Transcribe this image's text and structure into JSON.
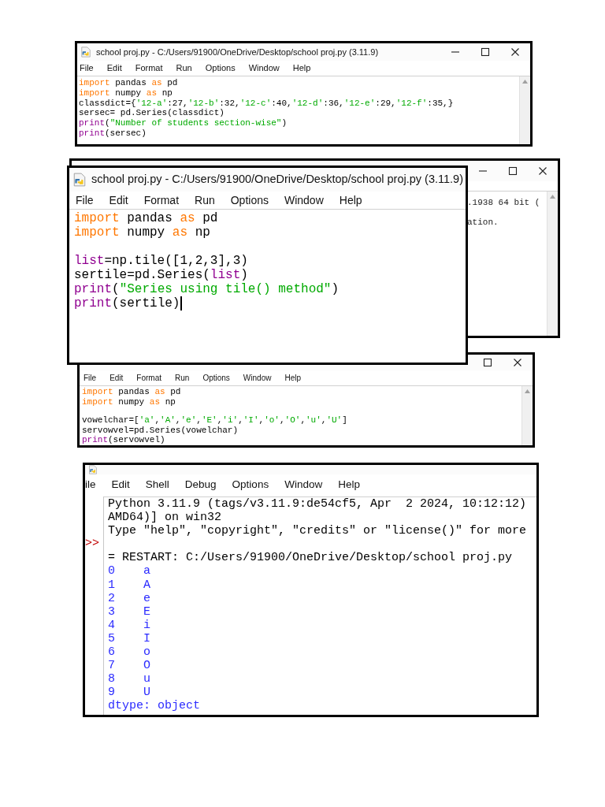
{
  "windows": [
    {
      "kind": "editor",
      "title": "school proj.py - C:/Users/91900/OneDrive/Desktop/school proj.py (3.11.9)",
      "controls": [
        {
          "kind": "minimize"
        },
        {
          "kind": "maximize"
        },
        {
          "kind": "close"
        }
      ],
      "menu": [
        "File",
        "Edit",
        "Format",
        "Run",
        "Options",
        "Window",
        "Help"
      ],
      "scrollbar": true,
      "lines": [
        {
          "kind": "code",
          "tokens": [
            {
              "kind": "keyword",
              "text": "import"
            },
            {
              "kind": "plain",
              "text": " pandas "
            },
            {
              "kind": "keyword",
              "text": "as"
            },
            {
              "kind": "plain",
              "text": " pd"
            }
          ]
        },
        {
          "kind": "code",
          "tokens": [
            {
              "kind": "keyword",
              "text": "import"
            },
            {
              "kind": "plain",
              "text": " numpy "
            },
            {
              "kind": "keyword",
              "text": "as"
            },
            {
              "kind": "plain",
              "text": " np"
            }
          ]
        },
        {
          "kind": "code",
          "tokens": [
            {
              "kind": "plain",
              "text": "classdict={"
            },
            {
              "kind": "string",
              "text": "'12-a'"
            },
            {
              "kind": "plain",
              "text": ":27,"
            },
            {
              "kind": "string",
              "text": "'12-b'"
            },
            {
              "kind": "plain",
              "text": ":32,"
            },
            {
              "kind": "string",
              "text": "'12-c'"
            },
            {
              "kind": "plain",
              "text": ":40,"
            },
            {
              "kind": "string",
              "text": "'12-d'"
            },
            {
              "kind": "plain",
              "text": ":36,"
            },
            {
              "kind": "string",
              "text": "'12-e'"
            },
            {
              "kind": "plain",
              "text": ":29,"
            },
            {
              "kind": "string",
              "text": "'12-f'"
            },
            {
              "kind": "plain",
              "text": ":35,}"
            }
          ]
        },
        {
          "kind": "code",
          "tokens": [
            {
              "kind": "plain",
              "text": "sersec= pd.Series(classdict)"
            }
          ]
        },
        {
          "kind": "code",
          "tokens": [
            {
              "kind": "builtin",
              "text": "print"
            },
            {
              "kind": "plain",
              "text": "("
            },
            {
              "kind": "string",
              "text": "\"Number of students section-wise\""
            },
            {
              "kind": "plain",
              "text": ")"
            }
          ]
        },
        {
          "kind": "code",
          "tokens": [
            {
              "kind": "builtin",
              "text": "print"
            },
            {
              "kind": "plain",
              "text": "(sersec)"
            }
          ]
        }
      ]
    },
    {
      "kind": "background",
      "controls": [
        {
          "kind": "minimize"
        },
        {
          "kind": "maximize"
        },
        {
          "kind": "close"
        }
      ],
      "scrollbar": true,
      "lines": [
        {
          "text": ".1938 64 bit ("
        },
        {
          "text": "ation."
        }
      ]
    },
    {
      "kind": "editor",
      "title": "school proj.py - C:/Users/91900/OneDrive/Desktop/school proj.py (3.11.9)",
      "menu": [
        "File",
        "Edit",
        "Format",
        "Run",
        "Options",
        "Window",
        "Help"
      ],
      "caret": true,
      "lines": [
        {
          "kind": "code",
          "tokens": [
            {
              "kind": "keyword",
              "text": "import"
            },
            {
              "kind": "plain",
              "text": " pandas "
            },
            {
              "kind": "keyword",
              "text": "as"
            },
            {
              "kind": "plain",
              "text": " pd"
            }
          ]
        },
        {
          "kind": "code",
          "tokens": [
            {
              "kind": "keyword",
              "text": "import"
            },
            {
              "kind": "plain",
              "text": " numpy "
            },
            {
              "kind": "keyword",
              "text": "as"
            },
            {
              "kind": "plain",
              "text": " np"
            }
          ]
        },
        {
          "kind": "blank"
        },
        {
          "kind": "code",
          "tokens": [
            {
              "kind": "builtin",
              "text": "list"
            },
            {
              "kind": "plain",
              "text": "=np.tile([1,2,3],3)"
            }
          ]
        },
        {
          "kind": "code",
          "tokens": [
            {
              "kind": "plain",
              "text": "sertile=pd.Series("
            },
            {
              "kind": "builtin",
              "text": "list"
            },
            {
              "kind": "plain",
              "text": ")"
            }
          ]
        },
        {
          "kind": "code",
          "tokens": [
            {
              "kind": "builtin",
              "text": "print"
            },
            {
              "kind": "plain",
              "text": "("
            },
            {
              "kind": "string",
              "text": "\"Series using tile() method\""
            },
            {
              "kind": "plain",
              "text": ")"
            }
          ]
        },
        {
          "kind": "code",
          "tokens": [
            {
              "kind": "builtin",
              "text": "print"
            },
            {
              "kind": "plain",
              "text": "(sertile)"
            }
          ]
        }
      ]
    },
    {
      "kind": "editor",
      "controls": [
        {
          "kind": "maximize"
        },
        {
          "kind": "close"
        }
      ],
      "menu": [
        "File",
        "Edit",
        "Format",
        "Run",
        "Options",
        "Window",
        "Help"
      ],
      "scrollbar": true,
      "lines": [
        {
          "kind": "code",
          "tokens": [
            {
              "kind": "keyword",
              "text": "import"
            },
            {
              "kind": "plain",
              "text": " pandas "
            },
            {
              "kind": "keyword",
              "text": "as"
            },
            {
              "kind": "plain",
              "text": " pd"
            }
          ]
        },
        {
          "kind": "code",
          "tokens": [
            {
              "kind": "keyword",
              "text": "import"
            },
            {
              "kind": "plain",
              "text": " numpy "
            },
            {
              "kind": "keyword",
              "text": "as"
            },
            {
              "kind": "plain",
              "text": " np"
            }
          ]
        },
        {
          "kind": "blank"
        },
        {
          "kind": "code",
          "tokens": [
            {
              "kind": "plain",
              "text": "vowelchar=["
            },
            {
              "kind": "string",
              "text": "'a'"
            },
            {
              "kind": "plain",
              "text": ","
            },
            {
              "kind": "string",
              "text": "'A'"
            },
            {
              "kind": "plain",
              "text": ","
            },
            {
              "kind": "string",
              "text": "'e'"
            },
            {
              "kind": "plain",
              "text": ","
            },
            {
              "kind": "string",
              "text": "'E'"
            },
            {
              "kind": "plain",
              "text": ","
            },
            {
              "kind": "string",
              "text": "'i'"
            },
            {
              "kind": "plain",
              "text": ","
            },
            {
              "kind": "string",
              "text": "'I'"
            },
            {
              "kind": "plain",
              "text": ","
            },
            {
              "kind": "string",
              "text": "'o'"
            },
            {
              "kind": "plain",
              "text": ","
            },
            {
              "kind": "string",
              "text": "'O'"
            },
            {
              "kind": "plain",
              "text": ","
            },
            {
              "kind": "string",
              "text": "'u'"
            },
            {
              "kind": "plain",
              "text": ","
            },
            {
              "kind": "string",
              "text": "'U'"
            },
            {
              "kind": "plain",
              "text": "]"
            }
          ]
        },
        {
          "kind": "code",
          "tokens": [
            {
              "kind": "plain",
              "text": "servowvel=pd.Series(vowelchar)"
            }
          ]
        },
        {
          "kind": "code",
          "tokens": [
            {
              "kind": "builtin",
              "text": "print"
            },
            {
              "kind": "plain",
              "text": "(servowvel)"
            }
          ]
        }
      ]
    },
    {
      "kind": "shell",
      "menu": [
        "ile",
        "Edit",
        "Shell",
        "Debug",
        "Options",
        "Window",
        "Help"
      ],
      "lines": [
        {
          "kind": "plain",
          "text": "Python 3.11.9 (tags/v3.11.9:de54cf5, Apr  2 2024, 10:12:12)"
        },
        {
          "kind": "plain",
          "text": "AMD64)] on win32"
        },
        {
          "kind": "plain",
          "text": "Type \"help\", \"copyright\", \"credits\" or \"license()\" for more"
        },
        {
          "kind": "prompt",
          "text": ">>"
        },
        {
          "kind": "plain",
          "text": "= RESTART: C:/Users/91900/OneDrive/Desktop/school proj.py"
        },
        {
          "kind": "output",
          "text": "0    a"
        },
        {
          "kind": "output",
          "text": "1    A"
        },
        {
          "kind": "output",
          "text": "2    e"
        },
        {
          "kind": "output",
          "text": "3    E"
        },
        {
          "kind": "output",
          "text": "4    i"
        },
        {
          "kind": "output",
          "text": "5    I"
        },
        {
          "kind": "output",
          "text": "6    o"
        },
        {
          "kind": "output",
          "text": "7    O"
        },
        {
          "kind": "output",
          "text": "8    u"
        },
        {
          "kind": "output",
          "text": "9    U"
        },
        {
          "kind": "output",
          "text": "dtype: object"
        }
      ]
    }
  ]
}
